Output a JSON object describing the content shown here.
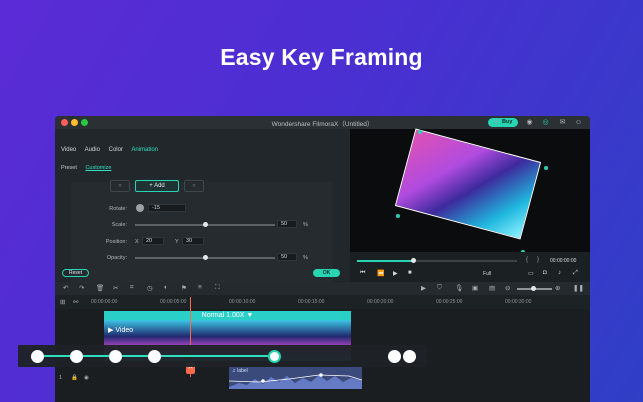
{
  "headline": "Easy Key Framing",
  "window": {
    "title": "Wondershare FilmoraX（Untitled）",
    "buy_label": "Buy"
  },
  "tabs": [
    {
      "label": "Video",
      "active": false
    },
    {
      "label": "Audio",
      "active": false
    },
    {
      "label": "Color",
      "active": false
    },
    {
      "label": "Animation",
      "active": true
    }
  ],
  "subtabs": [
    {
      "label": "Preset",
      "active": false
    },
    {
      "label": "Customize",
      "active": true
    }
  ],
  "keyframe": {
    "add_label": "+ Add"
  },
  "properties": {
    "rotate": {
      "label": "Rotate:",
      "value": "-15"
    },
    "scale": {
      "label": "Scale:",
      "value": "50",
      "unit": "%",
      "slider": 0.5
    },
    "position": {
      "label": "Position:",
      "x_label": "X",
      "x": "20",
      "y_label": "Y",
      "y": "30"
    },
    "opacity": {
      "label": "Opacity:",
      "value": "50",
      "unit": "%",
      "slider": 0.5
    }
  },
  "buttons": {
    "reset": "Reset",
    "ok": "OK"
  },
  "preview": {
    "timecode": "00:00:00:00",
    "quality": "Full",
    "progress": 0.35
  },
  "timeline": {
    "ticks": [
      "00:00:00:00",
      "00:00:05:00",
      "00:00:10:00",
      "00:00:15:00",
      "00:00:20:00",
      "00:00:25:00",
      "00:00:30:00"
    ],
    "clip_speed": "Normal 1.00X",
    "clip_name": "Video",
    "audio_label": "label",
    "track_number": "1"
  },
  "colors": {
    "accent": "#27d5b2",
    "playhead": "#ff6a4d"
  }
}
